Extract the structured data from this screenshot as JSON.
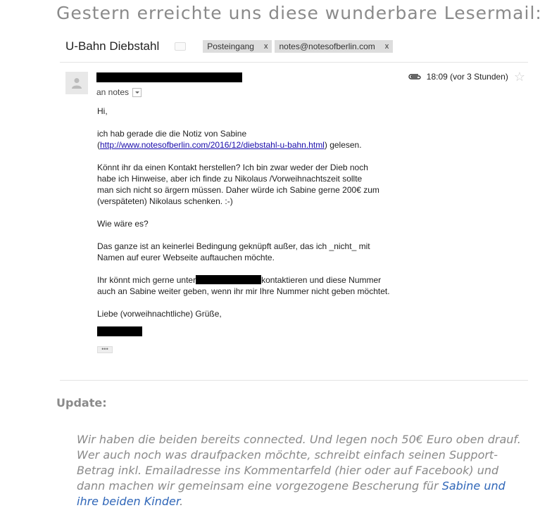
{
  "headline": "Gestern erreichte uns diese wunderbare Lesermail:",
  "email": {
    "subject": "U-Bahn Diebstahl",
    "labels": [
      {
        "text": "Posteingang",
        "remove": "x"
      },
      {
        "text": "notes@notesofberlin.com",
        "remove": "x"
      }
    ],
    "recipients": "an notes",
    "time": "18:09 (vor 3 Stunden)",
    "body": {
      "greeting": "Hi,",
      "para1_line1": "ich hab gerade die die Notiz von Sabine",
      "para1_open": "(",
      "para1_link": "http://www.notesofberlin.com/2016/12/diebstahl-u-bahn.html",
      "para1_close": ") gelesen.",
      "para2_lines": [
        "Könnt ihr da einen Kontakt herstellen? Ich bin zwar weder der Dieb noch",
        "habe ich Hinweise, aber ich finde zu Nikolaus /Vorweihnachtszeit sollte",
        "man sich nicht so ärgern müssen. Daher würde ich Sabine gerne 200€ zum",
        "(verspäteten) Nikolaus schenken. :-)"
      ],
      "question": "Wie wäre es?",
      "para3_lines": [
        "Das ganze ist an keinerlei Bedingung geknüpft außer, das ich _nicht_ mit",
        "Namen auf eurer Webseite auftauchen möchte."
      ],
      "para4_before": "Ihr könnt mich gerne unter",
      "para4_after": "kontaktieren und diese Nummer",
      "para4_line2": "auch an Sabine weiter geben, wenn ihr mir Ihre Nummer nicht geben möchtet.",
      "closing": "Liebe (vorweihnachtliche) Grüße,",
      "trimmed": "•••"
    }
  },
  "update": {
    "heading": "Update:",
    "text": "Wir haben die beiden bereits connected. Und legen noch 50€ Euro oben drauf. Wer auch noch was draufpacken möchte, schreibt einfach seinen Support-Betrag inkl. Emailadresse ins Kommentarfeld (hier oder auf Facebook) und dann machen wir gemeinsam eine vorgezogene Bescherung für ",
    "link_text": "Sabine und ihre beiden Kinder",
    "end": "."
  },
  "colors": {
    "muted_text": "#8a8a8a",
    "link_blue": "#2f66b8",
    "email_link": "#1a0dab"
  }
}
